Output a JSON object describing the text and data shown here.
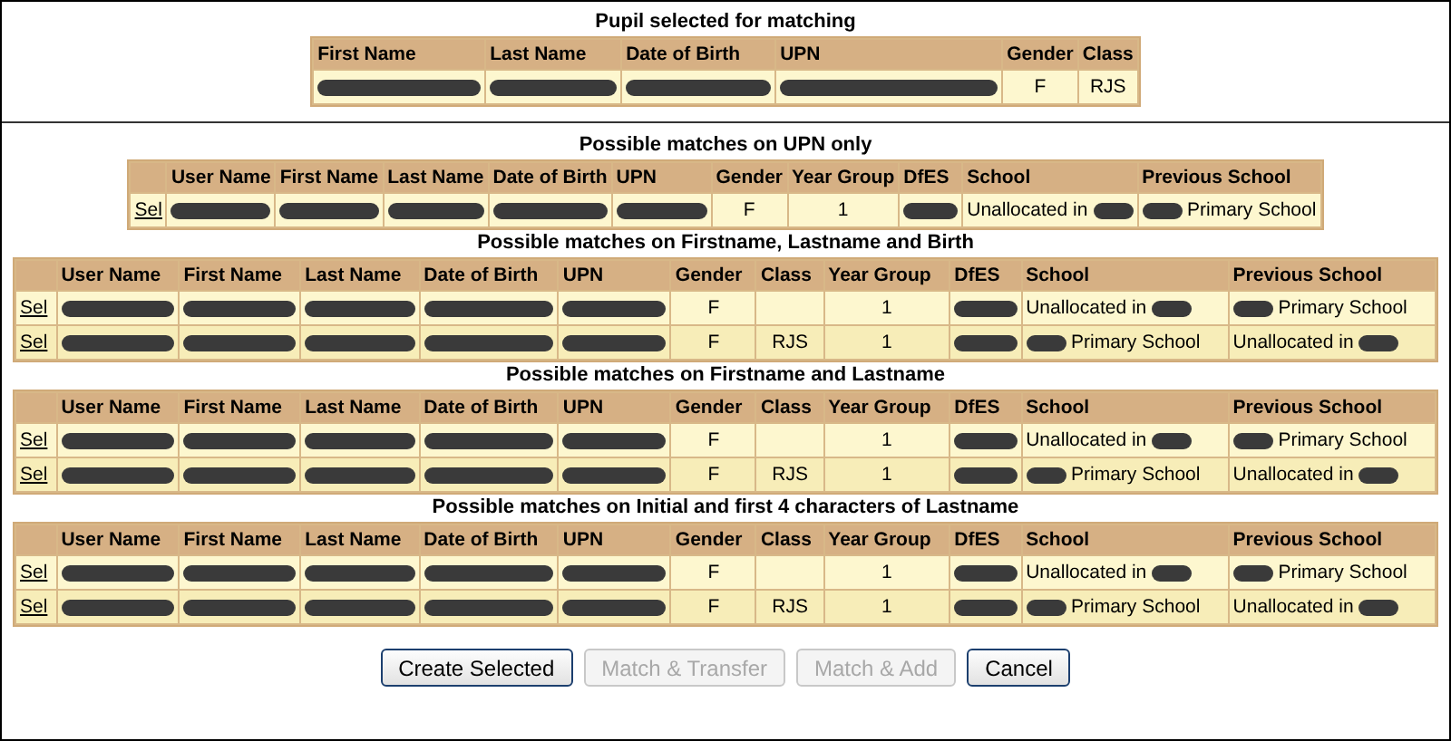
{
  "pupil_section": {
    "title": "Pupil selected for matching",
    "columns": [
      "First Name",
      "Last Name",
      "Date of Birth",
      "UPN",
      "Gender",
      "Class"
    ],
    "rows": [
      [
        {
          "kind": "redacted"
        },
        {
          "kind": "redacted"
        },
        {
          "kind": "redacted"
        },
        {
          "kind": "redacted"
        },
        {
          "kind": "text",
          "text": "F"
        },
        {
          "kind": "text",
          "text": "RJS"
        }
      ]
    ]
  },
  "match_sections": [
    {
      "title": "Possible matches on UPN only",
      "columns": [
        "User Name",
        "First Name",
        "Last Name",
        "Date of Birth",
        "UPN",
        "Gender",
        "Year Group",
        "DfES",
        "School",
        "Previous School"
      ],
      "rows": [
        {
          "link": "Sel",
          "cells": [
            {
              "kind": "redacted"
            },
            {
              "kind": "redacted"
            },
            {
              "kind": "redacted"
            },
            {
              "kind": "redacted"
            },
            {
              "kind": "redacted"
            },
            {
              "kind": "text",
              "text": "F"
            },
            {
              "kind": "text",
              "text": "1"
            },
            {
              "kind": "redacted"
            },
            {
              "kind": "text_then_redacted",
              "text": "Unallocated in"
            },
            {
              "kind": "redacted_then_text",
              "text": "Primary School"
            }
          ]
        }
      ]
    },
    {
      "title": "Possible matches on Firstname, Lastname and Birth",
      "columns": [
        "User Name",
        "First Name",
        "Last Name",
        "Date of Birth",
        "UPN",
        "Gender",
        "Class",
        "Year Group",
        "DfES",
        "School",
        "Previous School"
      ],
      "rows": [
        {
          "link": "Sel",
          "cells": [
            {
              "kind": "redacted"
            },
            {
              "kind": "redacted"
            },
            {
              "kind": "redacted"
            },
            {
              "kind": "redacted"
            },
            {
              "kind": "redacted"
            },
            {
              "kind": "text",
              "text": "F"
            },
            {
              "kind": "blank"
            },
            {
              "kind": "text",
              "text": "1"
            },
            {
              "kind": "redacted"
            },
            {
              "kind": "text_then_redacted",
              "text": "Unallocated in"
            },
            {
              "kind": "redacted_then_text",
              "text": "Primary School"
            }
          ]
        },
        {
          "link": "Sel",
          "cells": [
            {
              "kind": "redacted"
            },
            {
              "kind": "redacted"
            },
            {
              "kind": "redacted"
            },
            {
              "kind": "redacted"
            },
            {
              "kind": "redacted"
            },
            {
              "kind": "text",
              "text": "F"
            },
            {
              "kind": "text",
              "text": "RJS"
            },
            {
              "kind": "text",
              "text": "1"
            },
            {
              "kind": "redacted"
            },
            {
              "kind": "redacted_then_text",
              "text": "Primary School"
            },
            {
              "kind": "text_then_redacted",
              "text": "Unallocated in"
            }
          ]
        }
      ]
    },
    {
      "title": "Possible matches on Firstname and Lastname",
      "columns": [
        "User Name",
        "First Name",
        "Last Name",
        "Date of Birth",
        "UPN",
        "Gender",
        "Class",
        "Year Group",
        "DfES",
        "School",
        "Previous School"
      ],
      "rows": [
        {
          "link": "Sel",
          "cells": [
            {
              "kind": "redacted"
            },
            {
              "kind": "redacted"
            },
            {
              "kind": "redacted"
            },
            {
              "kind": "redacted"
            },
            {
              "kind": "redacted"
            },
            {
              "kind": "text",
              "text": "F"
            },
            {
              "kind": "blank"
            },
            {
              "kind": "text",
              "text": "1"
            },
            {
              "kind": "redacted"
            },
            {
              "kind": "text_then_redacted",
              "text": "Unallocated in"
            },
            {
              "kind": "redacted_then_text",
              "text": "Primary School"
            }
          ]
        },
        {
          "link": "Sel",
          "cells": [
            {
              "kind": "redacted"
            },
            {
              "kind": "redacted"
            },
            {
              "kind": "redacted"
            },
            {
              "kind": "redacted"
            },
            {
              "kind": "redacted"
            },
            {
              "kind": "text",
              "text": "F"
            },
            {
              "kind": "text",
              "text": "RJS"
            },
            {
              "kind": "text",
              "text": "1"
            },
            {
              "kind": "redacted"
            },
            {
              "kind": "redacted_then_text",
              "text": "Primary School"
            },
            {
              "kind": "text_then_redacted",
              "text": "Unallocated in"
            }
          ]
        }
      ]
    },
    {
      "title": "Possible matches on Initial and first 4 characters of Lastname",
      "columns": [
        "User Name",
        "First Name",
        "Last Name",
        "Date of Birth",
        "UPN",
        "Gender",
        "Class",
        "Year Group",
        "DfES",
        "School",
        "Previous School"
      ],
      "rows": [
        {
          "link": "Sel",
          "cells": [
            {
              "kind": "redacted"
            },
            {
              "kind": "redacted"
            },
            {
              "kind": "redacted"
            },
            {
              "kind": "redacted"
            },
            {
              "kind": "redacted"
            },
            {
              "kind": "text",
              "text": "F"
            },
            {
              "kind": "blank"
            },
            {
              "kind": "text",
              "text": "1"
            },
            {
              "kind": "redacted"
            },
            {
              "kind": "text_then_redacted",
              "text": "Unallocated in"
            },
            {
              "kind": "redacted_then_text",
              "text": "Primary School"
            }
          ]
        },
        {
          "link": "Sel",
          "cells": [
            {
              "kind": "redacted"
            },
            {
              "kind": "redacted"
            },
            {
              "kind": "redacted"
            },
            {
              "kind": "redacted"
            },
            {
              "kind": "redacted"
            },
            {
              "kind": "text",
              "text": "F"
            },
            {
              "kind": "text",
              "text": "RJS"
            },
            {
              "kind": "text",
              "text": "1"
            },
            {
              "kind": "redacted"
            },
            {
              "kind": "redacted_then_text",
              "text": "Primary School"
            },
            {
              "kind": "text_then_redacted",
              "text": "Unallocated in"
            }
          ]
        }
      ]
    }
  ],
  "buttons": [
    {
      "label": "Create Selected",
      "disabled": false
    },
    {
      "label": "Match & Transfer",
      "disabled": true
    },
    {
      "label": "Match & Add",
      "disabled": true
    },
    {
      "label": "Cancel",
      "disabled": false
    }
  ]
}
